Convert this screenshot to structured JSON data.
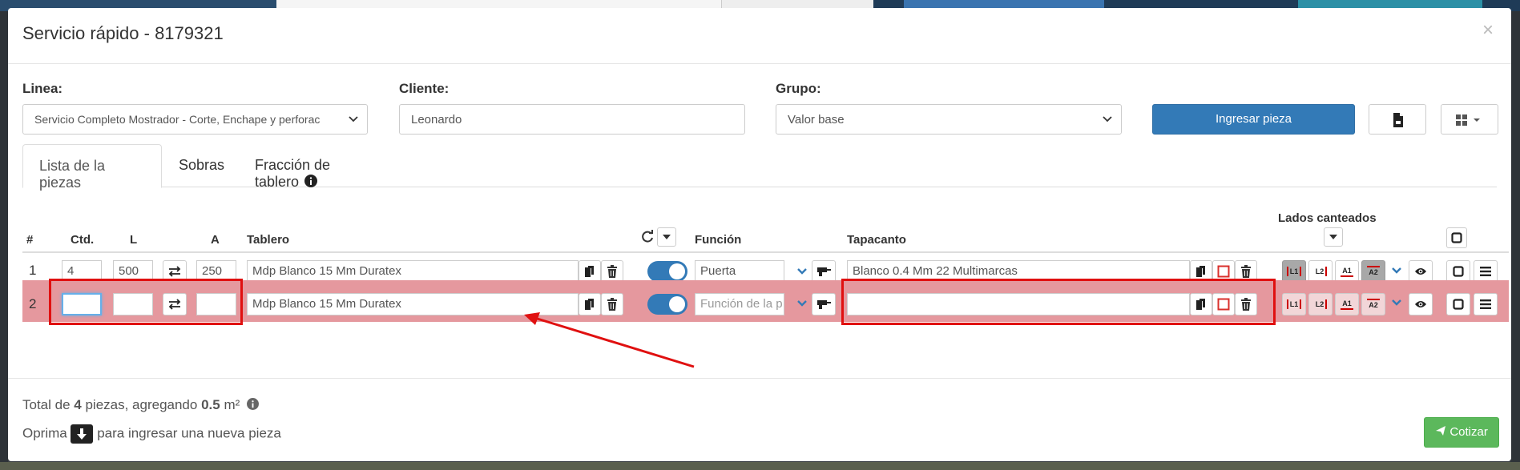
{
  "modal": {
    "title": "Servicio rápido - 8179321",
    "close": "×"
  },
  "form": {
    "linea_label": "Linea:",
    "linea_value": "Servicio Completo Mostrador - Corte, Enchape y perforac",
    "cliente_label": "Cliente:",
    "cliente_value": "Leonardo",
    "grupo_label": "Grupo:",
    "grupo_value": "Valor base",
    "ingresar_label": "Ingresar pieza"
  },
  "tabs": [
    {
      "label": "Lista de la piezas"
    },
    {
      "label": "Sobras"
    },
    {
      "label": "Fracción de tablero"
    }
  ],
  "table": {
    "headers": {
      "num": "#",
      "ctd": "Ctd.",
      "l": "L",
      "a": "A",
      "tablero": "Tablero",
      "funcion": "Función",
      "tapacanto": "Tapacanto",
      "lados": "Lados canteados"
    },
    "rows": [
      {
        "num": "1",
        "ctd": "4",
        "l": "500",
        "a": "250",
        "tablero": "Mdp Blanco 15 Mm Duratex",
        "funcion": "Puerta",
        "tapacanto": "Blanco 0.4 Mm 22 Multimarcas"
      },
      {
        "num": "2",
        "ctd": "",
        "l": "",
        "a": "",
        "tablero": "Mdp Blanco 15 Mm Duratex",
        "funcion_placeholder": "Función de la p",
        "tapacanto": ""
      }
    ],
    "lados": [
      "L1",
      "L2",
      "A1",
      "A2"
    ]
  },
  "footer": {
    "total_prefix": "Total de ",
    "total_count": "4",
    "total_mid": " piezas, agregando ",
    "total_area": "0.5",
    "total_unit": " m²",
    "hint_prefix": "Oprima ",
    "hint_suffix": " para ingresar una nueva pieza",
    "cotizar_label": "Cotizar"
  },
  "colors": {
    "primary": "#337ab7",
    "success": "#5cb85c",
    "row_highlight": "#e5989e",
    "annotation": "#e01010"
  }
}
